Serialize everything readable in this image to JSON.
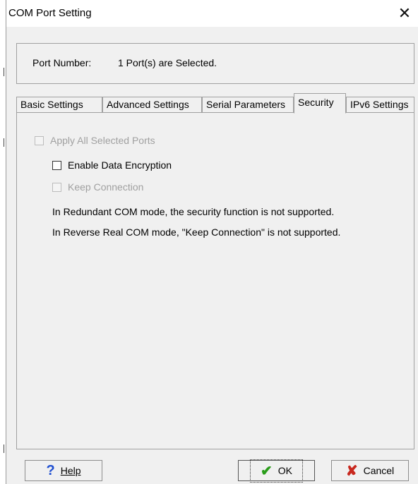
{
  "window": {
    "title": "COM Port Setting",
    "close_glyph": "✕"
  },
  "port": {
    "label": "Port Number:",
    "value": "1 Port(s) are Selected."
  },
  "tabs": [
    {
      "label": "Basic Settings"
    },
    {
      "label": "Advanced Settings"
    },
    {
      "label": "Serial Parameters"
    },
    {
      "label": "Security",
      "active": true
    },
    {
      "label": "IPv6 Settings"
    }
  ],
  "security": {
    "apply_all": "Apply All Selected Ports",
    "enable_encryption": "Enable Data Encryption",
    "keep_connection": "Keep Connection",
    "note_redundant": "In Redundant COM mode,  the security function is not supported.",
    "note_reverse": "In Reverse Real COM mode, \"Keep Connection\" is not supported."
  },
  "buttons": {
    "help_label": "Help",
    "ok_label": "OK",
    "cancel_label": "Cancel"
  },
  "colors": {
    "help_icon": "#1f4fd1",
    "ok_icon": "#2a9d1a",
    "cancel_icon": "#c8281e"
  },
  "icons": {
    "help": "question-icon",
    "ok": "checkmark-icon",
    "cancel": "x-icon"
  }
}
